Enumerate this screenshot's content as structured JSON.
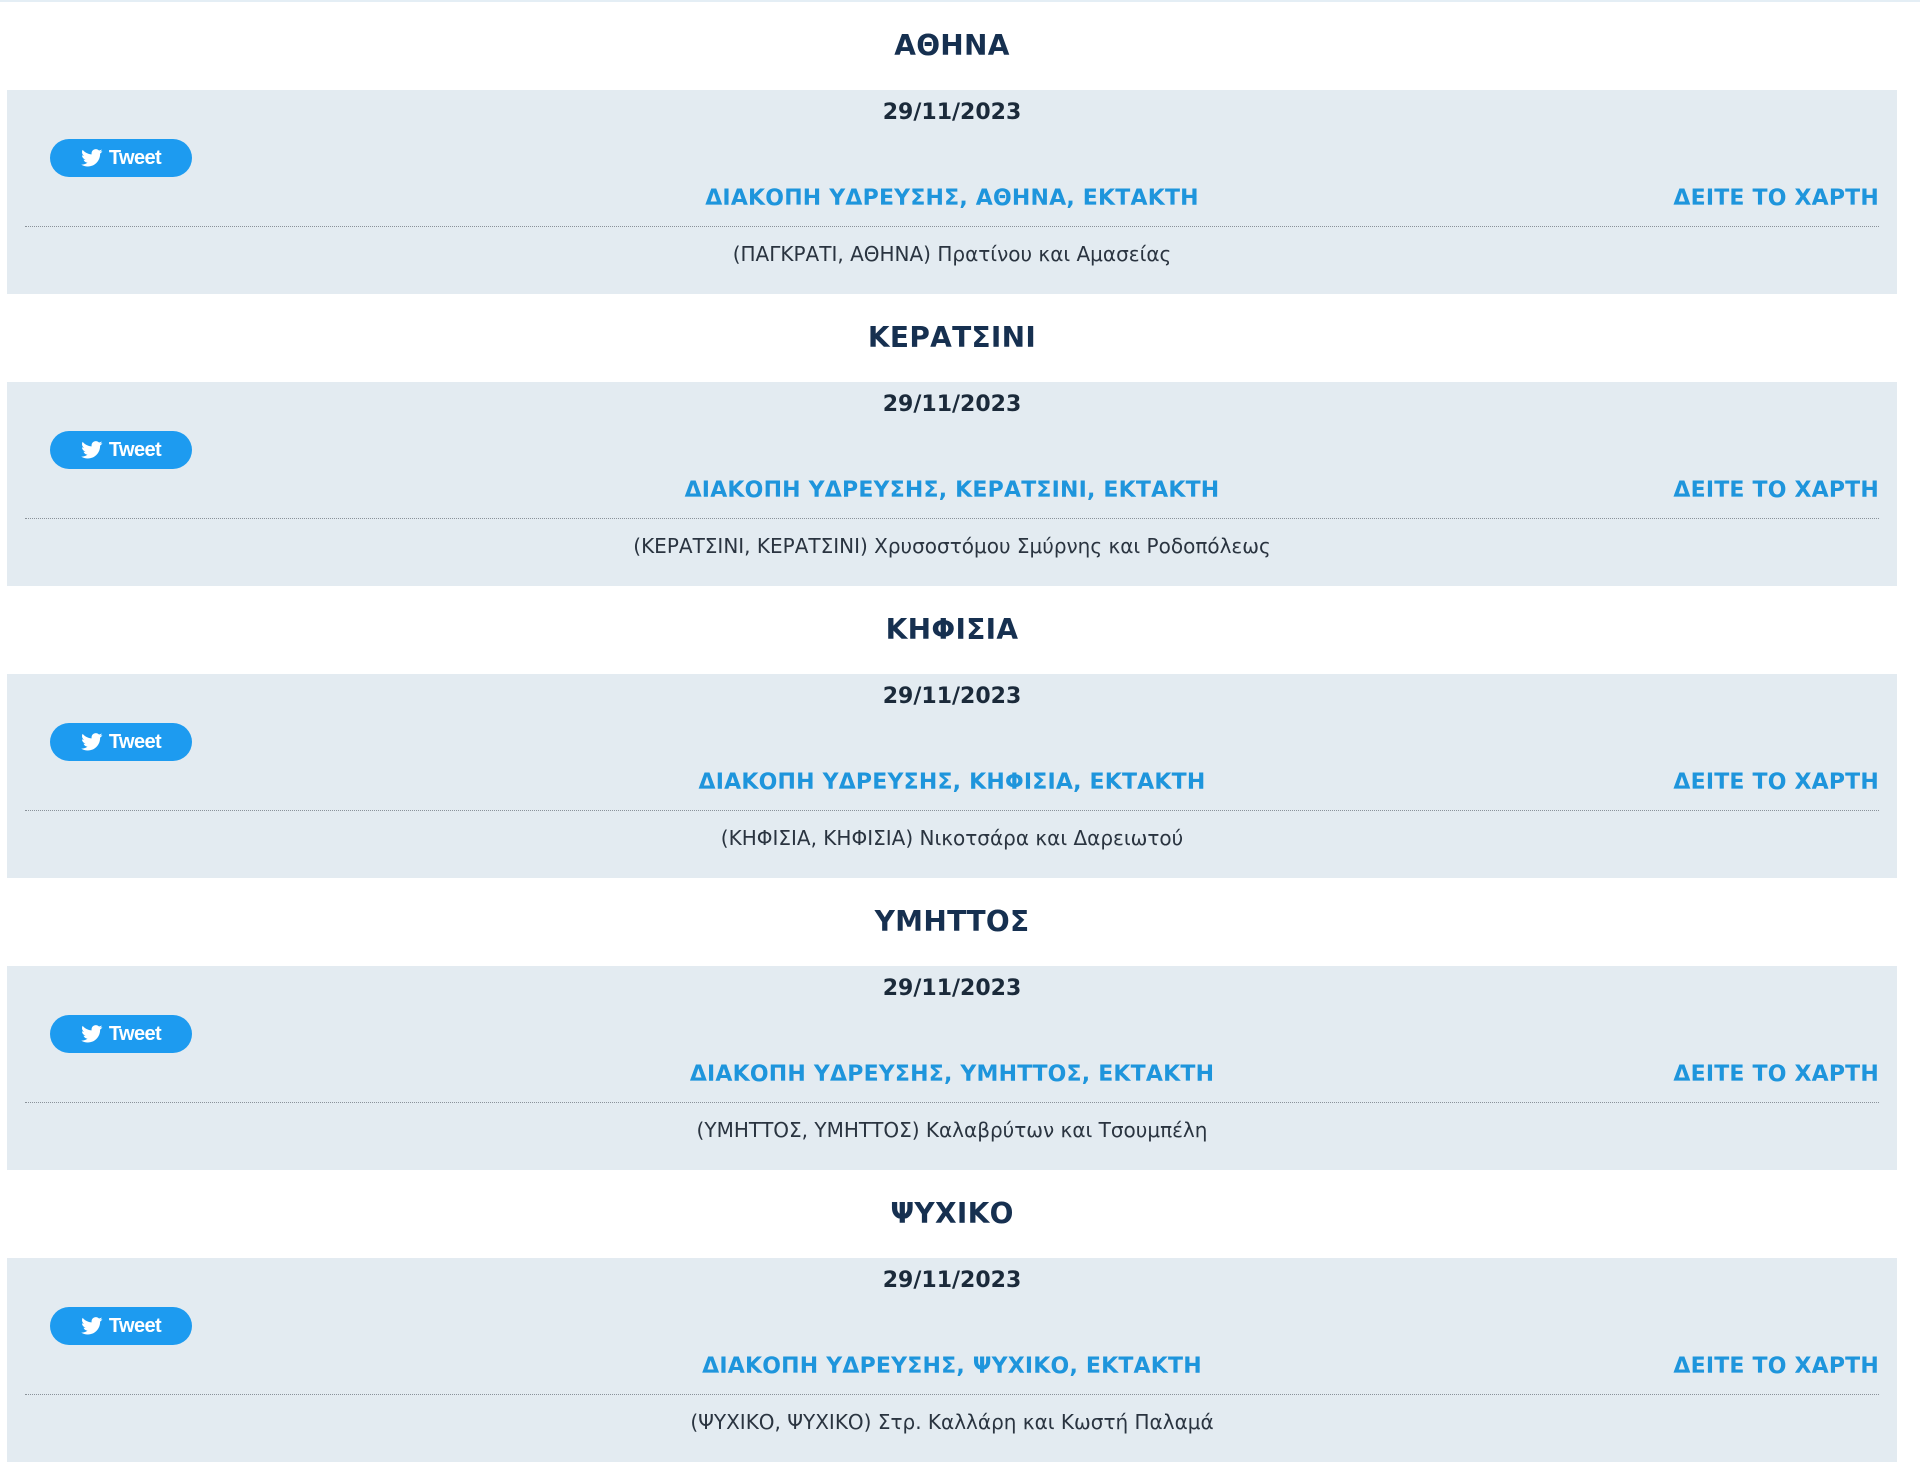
{
  "sections": [
    {
      "title": "ΑΘΗΝΑ",
      "date": "29/11/2023",
      "tweet_label": "Tweet",
      "headline": "ΔΙΑΚΟΠΗ ΥΔΡΕΥΣΗΣ, ΑΘΗΝΑ, ΕΚΤΑΚΤΗ",
      "map_link": "ΔΕΙΤΕ ΤΟ ΧΑΡΤΗ",
      "address": "(ΠΑΓΚΡΑΤΙ, ΑΘΗΝΑ) Πρατίνου και Αμασείας"
    },
    {
      "title": "ΚΕΡΑΤΣΙΝΙ",
      "date": "29/11/2023",
      "tweet_label": "Tweet",
      "headline": "ΔΙΑΚΟΠΗ ΥΔΡΕΥΣΗΣ, ΚΕΡΑΤΣΙΝΙ, ΕΚΤΑΚΤΗ",
      "map_link": "ΔΕΙΤΕ ΤΟ ΧΑΡΤΗ",
      "address": "(ΚΕΡΑΤΣΙΝΙ, ΚΕΡΑΤΣΙΝΙ) Χρυσοστόμου Σμύρνης και Ροδοπόλεως"
    },
    {
      "title": "ΚΗΦΙΣΙΑ",
      "date": "29/11/2023",
      "tweet_label": "Tweet",
      "headline": "ΔΙΑΚΟΠΗ ΥΔΡΕΥΣΗΣ, ΚΗΦΙΣΙΑ, ΕΚΤΑΚΤΗ",
      "map_link": "ΔΕΙΤΕ ΤΟ ΧΑΡΤΗ",
      "address": "(ΚΗΦΙΣΙΑ, ΚΗΦΙΣΙΑ) Νικοτσάρα και Δαρειωτού"
    },
    {
      "title": "ΥΜΗΤΤΟΣ",
      "date": "29/11/2023",
      "tweet_label": "Tweet",
      "headline": "ΔΙΑΚΟΠΗ ΥΔΡΕΥΣΗΣ, ΥΜΗΤΤΟΣ, ΕΚΤΑΚΤΗ",
      "map_link": "ΔΕΙΤΕ ΤΟ ΧΑΡΤΗ",
      "address": "(ΥΜΗΤΤΟΣ, ΥΜΗΤΤΟΣ) Καλαβρύτων και Τσουμπέλη"
    },
    {
      "title": "ΨΥΧΙΚΟ",
      "date": "29/11/2023",
      "tweet_label": "Tweet",
      "headline": "ΔΙΑΚΟΠΗ ΥΔΡΕΥΣΗΣ, ΨΥΧΙΚΟ, ΕΚΤΑΚΤΗ",
      "map_link": "ΔΕΙΤΕ ΤΟ ΧΑΡΤΗ",
      "address": "(ΨΥΧΙΚΟ, ΨΥΧΙΚΟ) Στρ. Καλλάρη και Κωστή Παλαμά"
    }
  ],
  "colors": {
    "card_background": "#e3ebf1",
    "title": "#163050",
    "link": "#1e95dc",
    "tweet_button": "#1d9bf0"
  },
  "icons": {
    "tweet": "twitter-bird-icon"
  }
}
